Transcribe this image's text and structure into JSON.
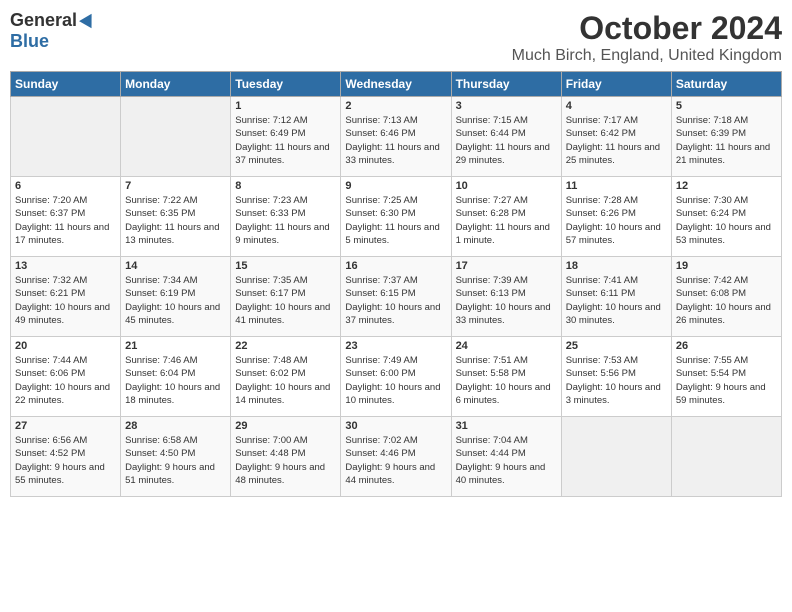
{
  "header": {
    "logo_general": "General",
    "logo_blue": "Blue",
    "title": "October 2024",
    "location": "Much Birch, England, United Kingdom"
  },
  "weekdays": [
    "Sunday",
    "Monday",
    "Tuesday",
    "Wednesday",
    "Thursday",
    "Friday",
    "Saturday"
  ],
  "weeks": [
    [
      {
        "day": "",
        "empty": true
      },
      {
        "day": "",
        "empty": true
      },
      {
        "day": "1",
        "sunrise": "Sunrise: 7:12 AM",
        "sunset": "Sunset: 6:49 PM",
        "daylight": "Daylight: 11 hours and 37 minutes."
      },
      {
        "day": "2",
        "sunrise": "Sunrise: 7:13 AM",
        "sunset": "Sunset: 6:46 PM",
        "daylight": "Daylight: 11 hours and 33 minutes."
      },
      {
        "day": "3",
        "sunrise": "Sunrise: 7:15 AM",
        "sunset": "Sunset: 6:44 PM",
        "daylight": "Daylight: 11 hours and 29 minutes."
      },
      {
        "day": "4",
        "sunrise": "Sunrise: 7:17 AM",
        "sunset": "Sunset: 6:42 PM",
        "daylight": "Daylight: 11 hours and 25 minutes."
      },
      {
        "day": "5",
        "sunrise": "Sunrise: 7:18 AM",
        "sunset": "Sunset: 6:39 PM",
        "daylight": "Daylight: 11 hours and 21 minutes."
      }
    ],
    [
      {
        "day": "6",
        "sunrise": "Sunrise: 7:20 AM",
        "sunset": "Sunset: 6:37 PM",
        "daylight": "Daylight: 11 hours and 17 minutes."
      },
      {
        "day": "7",
        "sunrise": "Sunrise: 7:22 AM",
        "sunset": "Sunset: 6:35 PM",
        "daylight": "Daylight: 11 hours and 13 minutes."
      },
      {
        "day": "8",
        "sunrise": "Sunrise: 7:23 AM",
        "sunset": "Sunset: 6:33 PM",
        "daylight": "Daylight: 11 hours and 9 minutes."
      },
      {
        "day": "9",
        "sunrise": "Sunrise: 7:25 AM",
        "sunset": "Sunset: 6:30 PM",
        "daylight": "Daylight: 11 hours and 5 minutes."
      },
      {
        "day": "10",
        "sunrise": "Sunrise: 7:27 AM",
        "sunset": "Sunset: 6:28 PM",
        "daylight": "Daylight: 11 hours and 1 minute."
      },
      {
        "day": "11",
        "sunrise": "Sunrise: 7:28 AM",
        "sunset": "Sunset: 6:26 PM",
        "daylight": "Daylight: 10 hours and 57 minutes."
      },
      {
        "day": "12",
        "sunrise": "Sunrise: 7:30 AM",
        "sunset": "Sunset: 6:24 PM",
        "daylight": "Daylight: 10 hours and 53 minutes."
      }
    ],
    [
      {
        "day": "13",
        "sunrise": "Sunrise: 7:32 AM",
        "sunset": "Sunset: 6:21 PM",
        "daylight": "Daylight: 10 hours and 49 minutes."
      },
      {
        "day": "14",
        "sunrise": "Sunrise: 7:34 AM",
        "sunset": "Sunset: 6:19 PM",
        "daylight": "Daylight: 10 hours and 45 minutes."
      },
      {
        "day": "15",
        "sunrise": "Sunrise: 7:35 AM",
        "sunset": "Sunset: 6:17 PM",
        "daylight": "Daylight: 10 hours and 41 minutes."
      },
      {
        "day": "16",
        "sunrise": "Sunrise: 7:37 AM",
        "sunset": "Sunset: 6:15 PM",
        "daylight": "Daylight: 10 hours and 37 minutes."
      },
      {
        "day": "17",
        "sunrise": "Sunrise: 7:39 AM",
        "sunset": "Sunset: 6:13 PM",
        "daylight": "Daylight: 10 hours and 33 minutes."
      },
      {
        "day": "18",
        "sunrise": "Sunrise: 7:41 AM",
        "sunset": "Sunset: 6:11 PM",
        "daylight": "Daylight: 10 hours and 30 minutes."
      },
      {
        "day": "19",
        "sunrise": "Sunrise: 7:42 AM",
        "sunset": "Sunset: 6:08 PM",
        "daylight": "Daylight: 10 hours and 26 minutes."
      }
    ],
    [
      {
        "day": "20",
        "sunrise": "Sunrise: 7:44 AM",
        "sunset": "Sunset: 6:06 PM",
        "daylight": "Daylight: 10 hours and 22 minutes."
      },
      {
        "day": "21",
        "sunrise": "Sunrise: 7:46 AM",
        "sunset": "Sunset: 6:04 PM",
        "daylight": "Daylight: 10 hours and 18 minutes."
      },
      {
        "day": "22",
        "sunrise": "Sunrise: 7:48 AM",
        "sunset": "Sunset: 6:02 PM",
        "daylight": "Daylight: 10 hours and 14 minutes."
      },
      {
        "day": "23",
        "sunrise": "Sunrise: 7:49 AM",
        "sunset": "Sunset: 6:00 PM",
        "daylight": "Daylight: 10 hours and 10 minutes."
      },
      {
        "day": "24",
        "sunrise": "Sunrise: 7:51 AM",
        "sunset": "Sunset: 5:58 PM",
        "daylight": "Daylight: 10 hours and 6 minutes."
      },
      {
        "day": "25",
        "sunrise": "Sunrise: 7:53 AM",
        "sunset": "Sunset: 5:56 PM",
        "daylight": "Daylight: 10 hours and 3 minutes."
      },
      {
        "day": "26",
        "sunrise": "Sunrise: 7:55 AM",
        "sunset": "Sunset: 5:54 PM",
        "daylight": "Daylight: 9 hours and 59 minutes."
      }
    ],
    [
      {
        "day": "27",
        "sunrise": "Sunrise: 6:56 AM",
        "sunset": "Sunset: 4:52 PM",
        "daylight": "Daylight: 9 hours and 55 minutes."
      },
      {
        "day": "28",
        "sunrise": "Sunrise: 6:58 AM",
        "sunset": "Sunset: 4:50 PM",
        "daylight": "Daylight: 9 hours and 51 minutes."
      },
      {
        "day": "29",
        "sunrise": "Sunrise: 7:00 AM",
        "sunset": "Sunset: 4:48 PM",
        "daylight": "Daylight: 9 hours and 48 minutes."
      },
      {
        "day": "30",
        "sunrise": "Sunrise: 7:02 AM",
        "sunset": "Sunset: 4:46 PM",
        "daylight": "Daylight: 9 hours and 44 minutes."
      },
      {
        "day": "31",
        "sunrise": "Sunrise: 7:04 AM",
        "sunset": "Sunset: 4:44 PM",
        "daylight": "Daylight: 9 hours and 40 minutes."
      },
      {
        "day": "",
        "empty": true
      },
      {
        "day": "",
        "empty": true
      }
    ]
  ]
}
